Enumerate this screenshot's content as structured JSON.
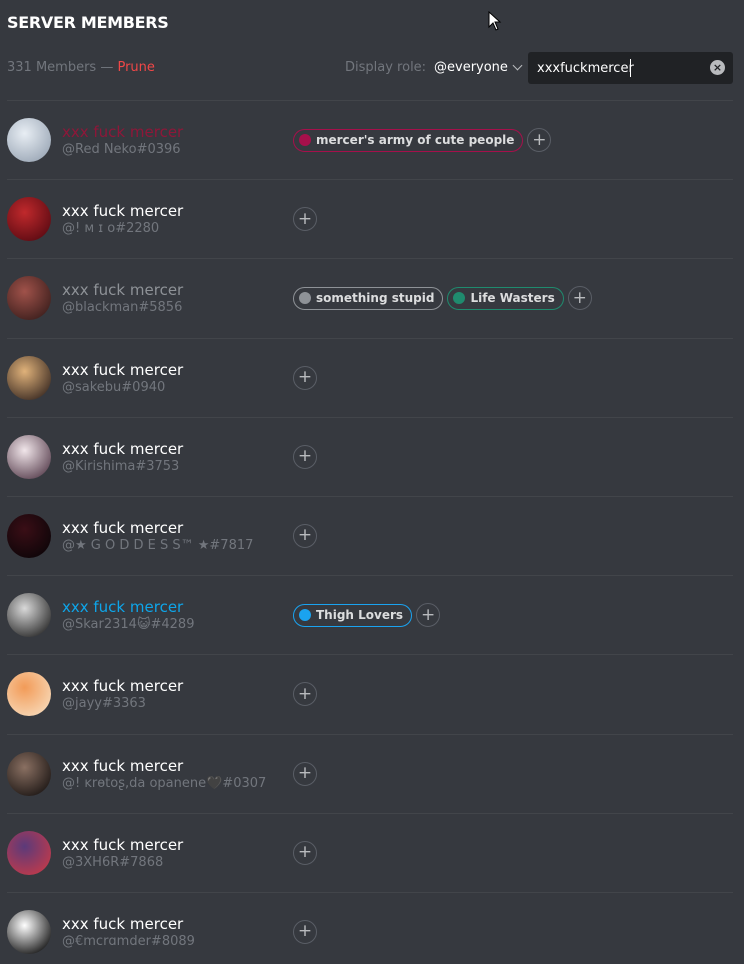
{
  "header": {
    "title": "SERVER MEMBERS"
  },
  "toolbar": {
    "member_count": "331 Members",
    "separator": " — ",
    "prune_label": "Prune",
    "display_role_label": "Display role:",
    "display_role_value": "@everyone",
    "search_value": "xxxfuckmercer"
  },
  "colors": {
    "background": "#36393f",
    "search_bg": "#202225",
    "prune": "#f04747"
  },
  "members": [
    {
      "name": "xxx fuck mercer",
      "tag": "@Red Neko#0396",
      "name_color": "#8e1739",
      "avatar_colors": [
        "#e8eef4",
        "#9aa6b5"
      ],
      "roles": [
        {
          "label": "mercer's army of cute people",
          "color": "#a6104b"
        }
      ]
    },
    {
      "name": "xxx fuck mercer",
      "tag": "@! ᴍ ɪ o#2280",
      "name_color": "#ffffff",
      "avatar_colors": [
        "#c0292c",
        "#5a0a12"
      ],
      "roles": []
    },
    {
      "name": "xxx fuck mercer",
      "tag": "@blackman#5856",
      "name_color": "#8e9297",
      "avatar_colors": [
        "#a0524a",
        "#3b1e1c"
      ],
      "roles": [
        {
          "label": "something stupid",
          "color": "#8e9297"
        },
        {
          "label": "Life Wasters",
          "color": "#1f8b6e"
        }
      ]
    },
    {
      "name": "xxx fuck mercer",
      "tag": "@sakebu#0940",
      "name_color": "#ffffff",
      "avatar_colors": [
        "#e0b27a",
        "#3a2a22"
      ],
      "roles": []
    },
    {
      "name": "xxx fuck mercer",
      "tag": "@Kirishima#3753",
      "name_color": "#ffffff",
      "avatar_colors": [
        "#f1e6ea",
        "#5a4150"
      ],
      "roles": []
    },
    {
      "name": "xxx fuck mercer",
      "tag": "@★ G O D D E S S™ ★#7817",
      "name_color": "#ffffff",
      "avatar_colors": [
        "#3a0e16",
        "#0c0508"
      ],
      "roles": []
    },
    {
      "name": "xxx fuck mercer",
      "tag": "@Skar2314😺#4289",
      "name_color": "#0ea5e9",
      "avatar_colors": [
        "#d9d9d9",
        "#2a2a2a"
      ],
      "roles": [
        {
          "label": "Thigh Lovers",
          "color": "#1aa3f0"
        }
      ]
    },
    {
      "name": "xxx fuck mercer",
      "tag": "@jayy#3363",
      "name_color": "#ffffff",
      "avatar_colors": [
        "#f29b58",
        "#f7d9b8"
      ],
      "roles": []
    },
    {
      "name": "xxx fuck mercer",
      "tag": "@! ĸrɵtoʂ,da opanene🖤#0307",
      "name_color": "#ffffff",
      "avatar_colors": [
        "#8a7062",
        "#1c1614"
      ],
      "roles": []
    },
    {
      "name": "xxx fuck mercer",
      "tag": "@3XH6R#7868",
      "name_color": "#ffffff",
      "avatar_colors": [
        "#5b3a7a",
        "#c23a4a"
      ],
      "roles": []
    },
    {
      "name": "xxx fuck mercer",
      "tag": "@€mcrɑmder#8089",
      "name_color": "#ffffff",
      "avatar_colors": [
        "#ffffff",
        "#111111"
      ],
      "roles": []
    }
  ]
}
